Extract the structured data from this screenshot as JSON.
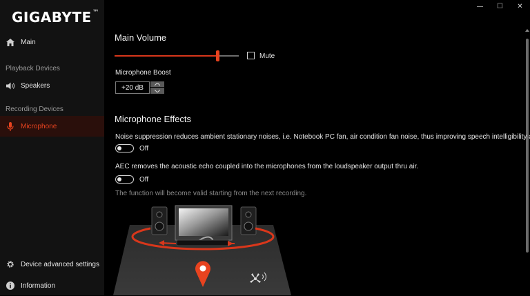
{
  "brand": {
    "logo_text": "GIGABYTE",
    "logo_mark": "™"
  },
  "window_controls": {
    "minimize": "—",
    "maximize": "☐",
    "close": "✕"
  },
  "sidebar": {
    "main": {
      "label": "Main",
      "icon": "home-icon"
    },
    "playback_section": "Playback Devices",
    "speakers": {
      "label": "Speakers",
      "icon": "speaker-icon"
    },
    "recording_section": "Recording Devices",
    "microphone": {
      "label": "Microphone",
      "icon": "microphone-icon",
      "active": true
    },
    "device_settings": {
      "label": "Device advanced settings",
      "icon": "gear-icon"
    },
    "information": {
      "label": "Information",
      "icon": "info-icon"
    }
  },
  "main": {
    "volume_title": "Main Volume",
    "volume_value": 0.83,
    "mute_label": "Mute",
    "mute_checked": false,
    "boost_label": "Microphone Boost",
    "boost_value": "+20 dB",
    "effects_title": "Microphone Effects",
    "noise_desc": "Noise suppression reduces ambient stationary noises, i.e. Notebook PC fan, air condition fan noise, thus improving speech intelligibility and r",
    "noise_state": "Off",
    "aec_desc": "AEC removes the acoustic echo coupled into the microphones from the loudspeaker output thru air.",
    "aec_state": "Off",
    "note": "The function will become valid starting from the next recording."
  },
  "colors": {
    "accent": "#e8431f",
    "active_bg": "#2a0f0b",
    "sidebar_bg": "#121212",
    "background": "#000000"
  }
}
